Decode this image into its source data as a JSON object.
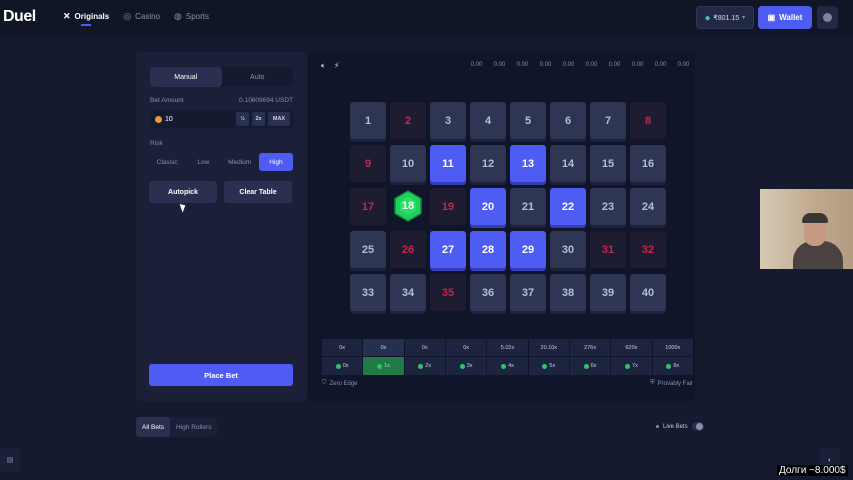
{
  "header": {
    "logo": "Duel",
    "nav": [
      {
        "label": "Originals",
        "icon": "✕",
        "icon_name": "originals-icon",
        "active": true
      },
      {
        "label": "Casino",
        "icon": "◎",
        "icon_name": "casino-icon",
        "active": false
      },
      {
        "label": "Sports",
        "icon": "◍",
        "icon_name": "sports-icon",
        "active": false
      }
    ],
    "balance": "₹801.15",
    "wallet_label": "Wallet"
  },
  "panel": {
    "modes": [
      "Manual",
      "Auto"
    ],
    "active_mode": "Manual",
    "bet_amount_label": "Bet Amount",
    "bet_amount_usdt": "0.10609694 USDT",
    "bet_value": "10",
    "half_label": "½",
    "double_label": "2x",
    "max_label": "MAX",
    "risk_label": "Risk",
    "risk_options": [
      "Classic",
      "Low",
      "Medium",
      "High"
    ],
    "active_risk": "High",
    "autopick_label": "Autopick",
    "clear_label": "Clear Table",
    "place_bet_label": "Place Bet"
  },
  "game": {
    "history": [
      "0.00",
      "0.00",
      "0.00",
      "0.00",
      "0.00",
      "0.00",
      "0.00",
      "0.00",
      "0.00",
      "0.00"
    ],
    "tiles": [
      {
        "n": "1",
        "state": "normal"
      },
      {
        "n": "2",
        "state": "red"
      },
      {
        "n": "3",
        "state": "normal"
      },
      {
        "n": "4",
        "state": "normal"
      },
      {
        "n": "5",
        "state": "normal"
      },
      {
        "n": "6",
        "state": "normal"
      },
      {
        "n": "7",
        "state": "normal"
      },
      {
        "n": "8",
        "state": "red"
      },
      {
        "n": "9",
        "state": "red"
      },
      {
        "n": "10",
        "state": "normal"
      },
      {
        "n": "11",
        "state": "picked"
      },
      {
        "n": "12",
        "state": "normal"
      },
      {
        "n": "13",
        "state": "picked"
      },
      {
        "n": "14",
        "state": "normal"
      },
      {
        "n": "15",
        "state": "normal"
      },
      {
        "n": "16",
        "state": "normal"
      },
      {
        "n": "17",
        "state": "red"
      },
      {
        "n": "18",
        "state": "hit"
      },
      {
        "n": "19",
        "state": "red"
      },
      {
        "n": "20",
        "state": "picked"
      },
      {
        "n": "21",
        "state": "normal"
      },
      {
        "n": "22",
        "state": "picked"
      },
      {
        "n": "23",
        "state": "normal"
      },
      {
        "n": "24",
        "state": "normal"
      },
      {
        "n": "25",
        "state": "normal"
      },
      {
        "n": "26",
        "state": "red"
      },
      {
        "n": "27",
        "state": "picked"
      },
      {
        "n": "28",
        "state": "picked"
      },
      {
        "n": "29",
        "state": "picked"
      },
      {
        "n": "30",
        "state": "normal"
      },
      {
        "n": "31",
        "state": "red"
      },
      {
        "n": "32",
        "state": "red"
      },
      {
        "n": "33",
        "state": "normal"
      },
      {
        "n": "34",
        "state": "normal"
      },
      {
        "n": "35",
        "state": "red"
      },
      {
        "n": "36",
        "state": "normal"
      },
      {
        "n": "37",
        "state": "normal"
      },
      {
        "n": "38",
        "state": "normal"
      },
      {
        "n": "39",
        "state": "normal"
      },
      {
        "n": "40",
        "state": "normal"
      }
    ],
    "payouts": [
      {
        "mult": "0x",
        "hits": "0x"
      },
      {
        "mult": "0x",
        "hits": "1x",
        "highlight": true
      },
      {
        "mult": "0x",
        "hits": "2x"
      },
      {
        "mult": "0x",
        "hits": "3x"
      },
      {
        "mult": "5.02x",
        "hits": "4x"
      },
      {
        "mult": "20.10x",
        "hits": "5x"
      },
      {
        "mult": "276x",
        "hits": "6x"
      },
      {
        "mult": "620x",
        "hits": "7x"
      },
      {
        "mult": "1000x",
        "hits": "8x"
      }
    ],
    "zero_edge": "Zero Edge",
    "provably_fair": "Provably Fair"
  },
  "bets": {
    "tabs": [
      "All Bets",
      "High Rollers"
    ],
    "live_bets_label": "Live Bets"
  },
  "overlay": {
    "debt_caption": "Долги ~8.000$"
  },
  "colors": {
    "accent": "#4f5cf4",
    "red_number": "#c8264c",
    "hit_green": "#1fd15a"
  }
}
